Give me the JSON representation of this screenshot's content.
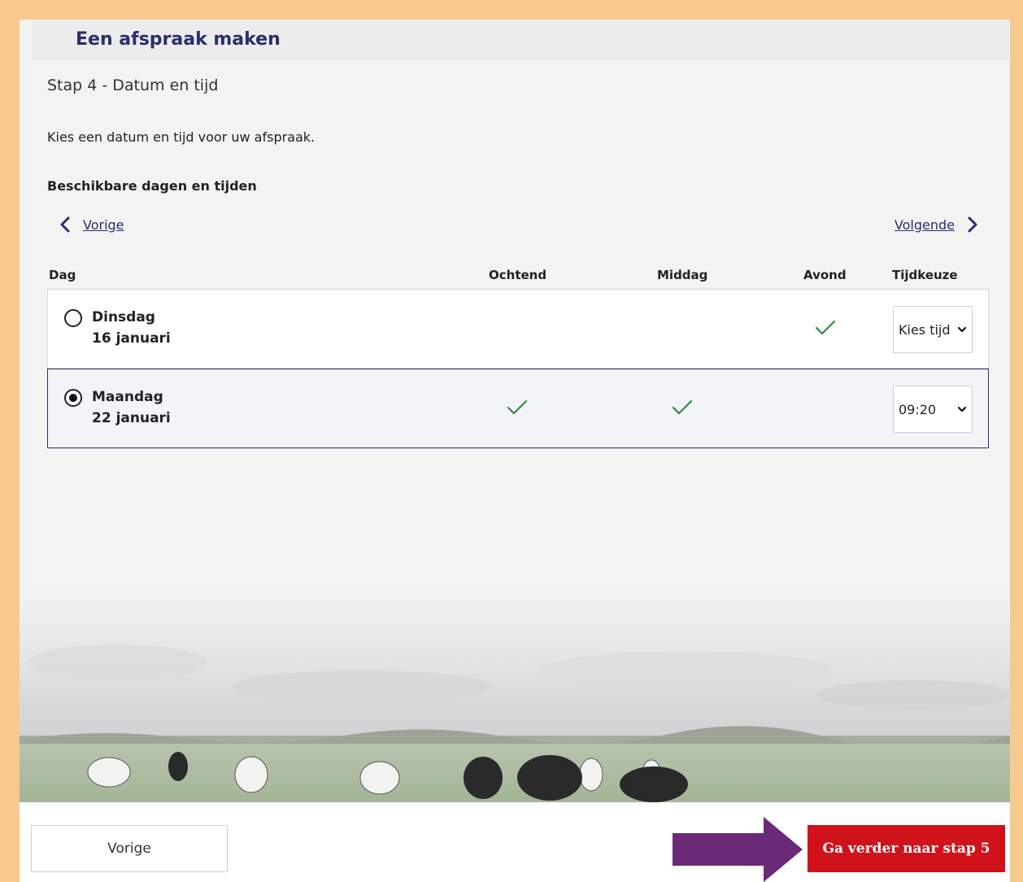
{
  "header": {
    "title": "Een afspraak maken"
  },
  "step": {
    "title": "Stap 4 - Datum en tijd",
    "intro": "Kies een datum en tijd voor uw afspraak.",
    "section_heading": "Beschikbare dagen en tijden"
  },
  "navigation": {
    "prev_label": "Vorige",
    "next_label": "Volgende"
  },
  "table": {
    "columns": {
      "day": "Dag",
      "morning": "Ochtend",
      "afternoon": "Middag",
      "evening": "Avond",
      "time": "Tijdkeuze"
    },
    "rows": [
      {
        "day": "Dinsdag",
        "date": "16 januari",
        "morning": false,
        "afternoon": false,
        "evening": true,
        "selected": false,
        "time_value": "Kies tijd"
      },
      {
        "day": "Maandag",
        "date": "22 januari",
        "morning": true,
        "afternoon": true,
        "evening": false,
        "selected": true,
        "time_value": "09:20"
      }
    ]
  },
  "footer": {
    "back_label": "Vorige",
    "next_label": "Ga verder naar stap 5"
  },
  "colors": {
    "accent": "#2b2e6e",
    "primary_button": "#d0121b",
    "check": "#2e8b3a",
    "frame": "#f7c98f",
    "annotation_arrow": "#6b2a78"
  }
}
